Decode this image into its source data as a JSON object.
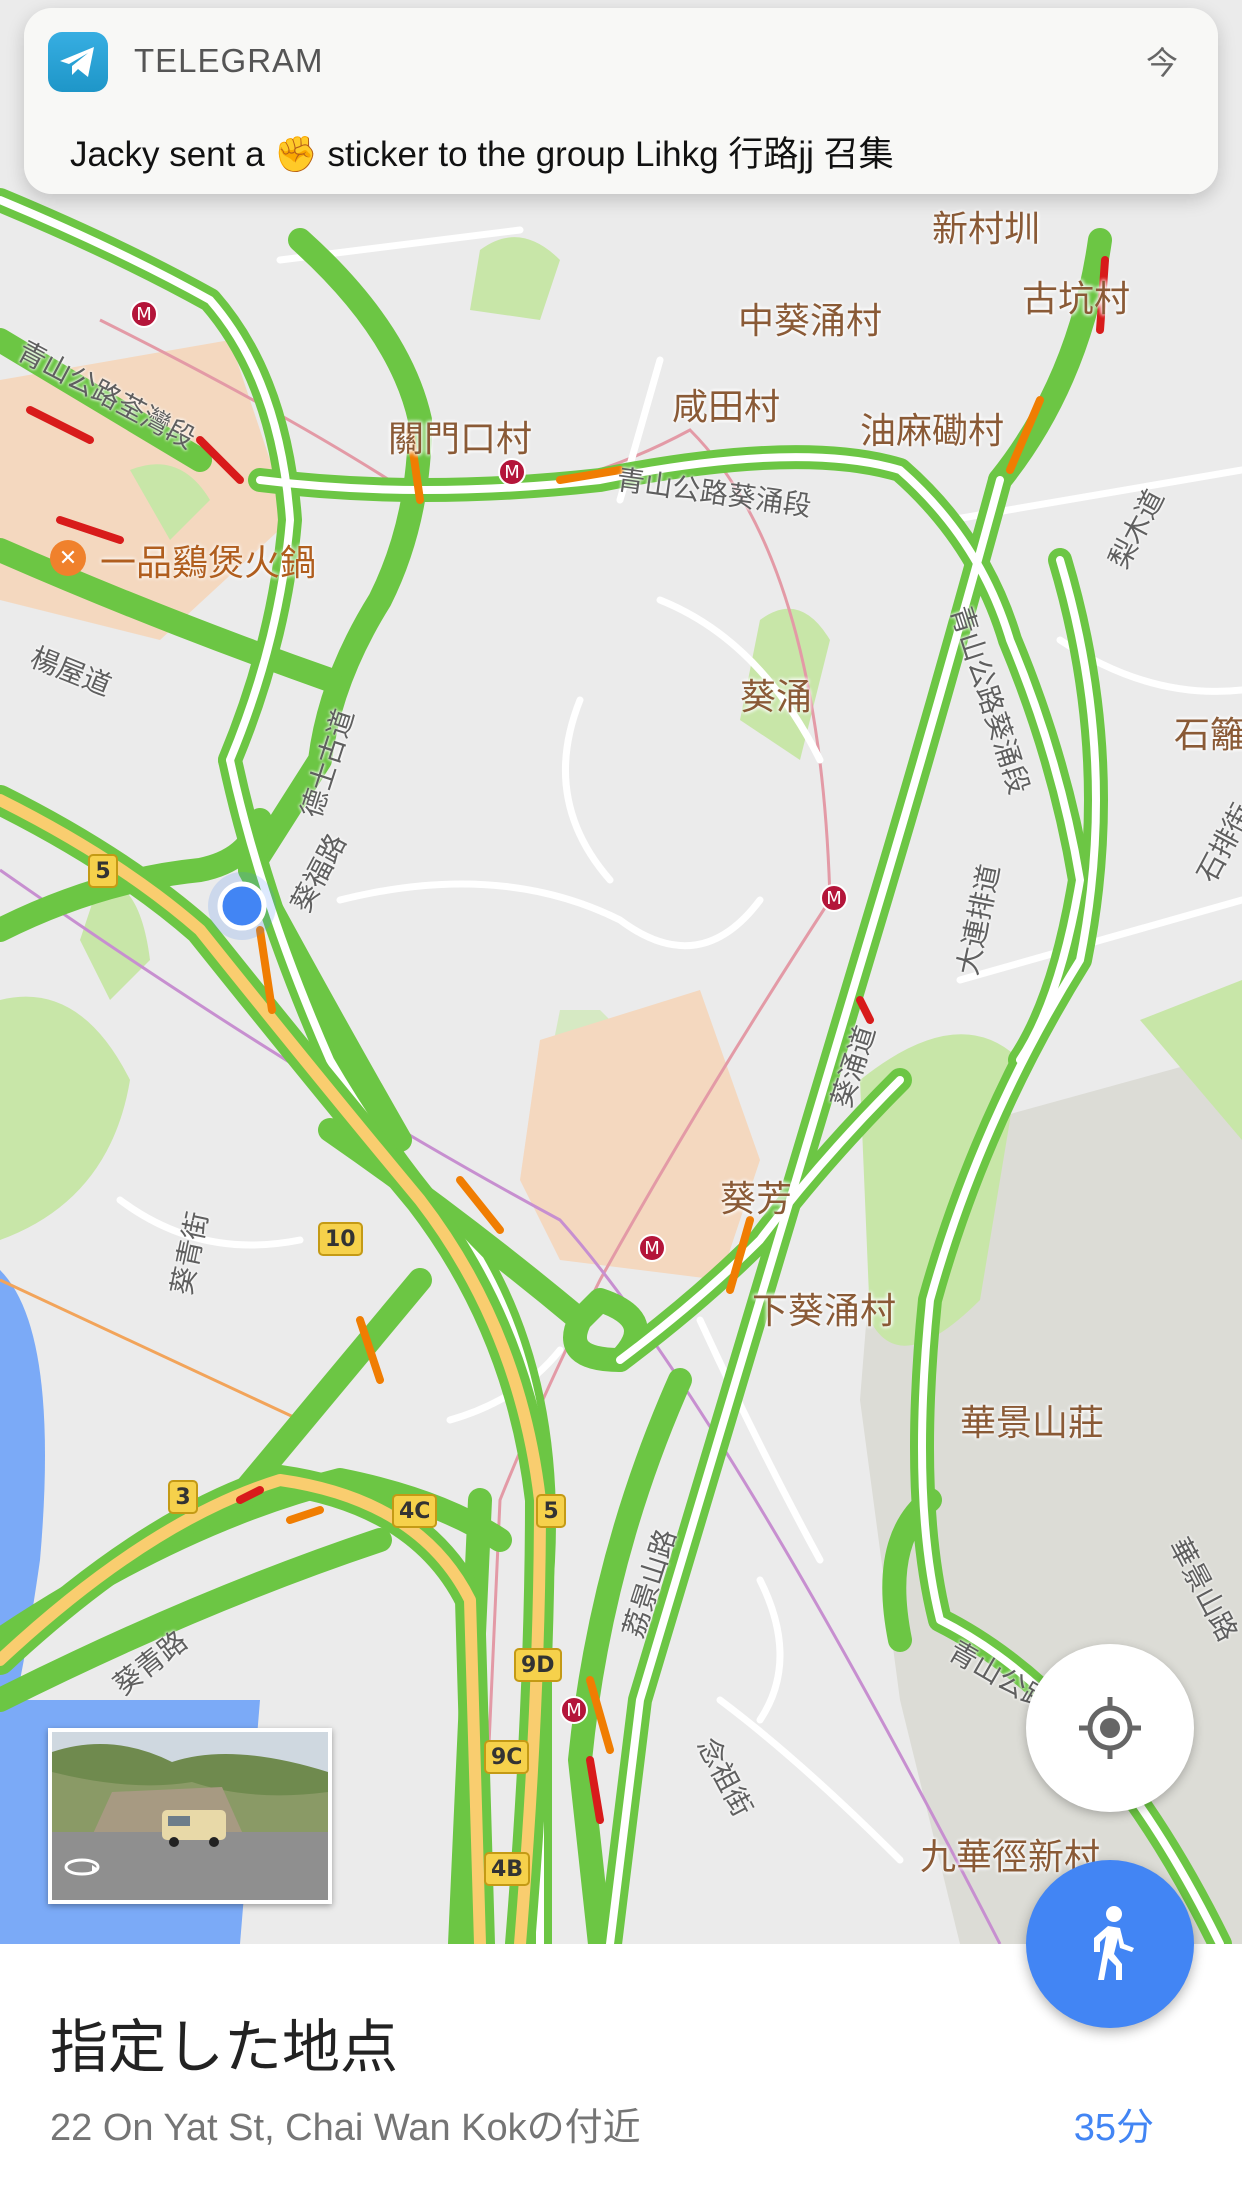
{
  "notification": {
    "app_name": "TELEGRAM",
    "time": "今",
    "message": "Jacky sent a ✊ sticker to the group Lihkg 行路jj 召集",
    "icon": "telegram-icon"
  },
  "map": {
    "place_labels": [
      "中葵涌村",
      "古坑村",
      "咸田村",
      "油麻磡村",
      "關門口村",
      "葵涌",
      "石籬",
      "葵芳",
      "下葵涌村",
      "華景山莊",
      "九華徑新村",
      "新村圳"
    ],
    "road_labels": [
      "青山公路荃灣段",
      "青山公路葵涌段",
      "梨木道",
      "楊屋道",
      "德士古道",
      "葵福路",
      "大連排道",
      "葵涌道",
      "青山公路葵涌段",
      "石排街",
      "葵青路",
      "葵青街",
      "荔景山路",
      "念祖街",
      "華景山路",
      "青山公路"
    ],
    "poi_label": "一品鷄煲火鍋",
    "route_shields": [
      "5",
      "10",
      "3",
      "4C",
      "5",
      "9D",
      "9C",
      "4B"
    ],
    "colors": {
      "traffic_green": "#6cc644",
      "traffic_orange": "#f07d02",
      "traffic_red": "#d81b1b",
      "highway": "#f9cd6f",
      "water": "#7baaf7",
      "park": "#c8e6a8",
      "mall": "#f4d8bf",
      "accent_blue": "#4285f4"
    }
  },
  "street_view": {
    "icon": "rotate-360-icon"
  },
  "buttons": {
    "my_location_icon": "crosshair-icon",
    "walk_icon": "walking-person-icon"
  },
  "sheet": {
    "title": "指定した地点",
    "subtitle": "22 On Yat St, Chai Wan Kokの付近",
    "duration": "35分"
  }
}
